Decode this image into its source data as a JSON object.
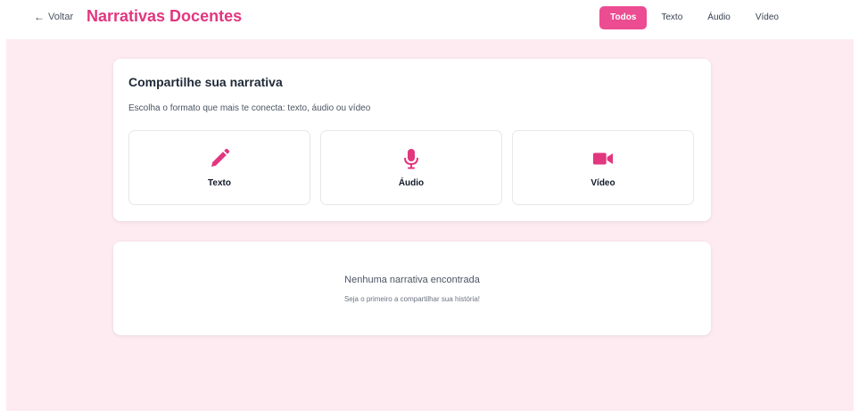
{
  "header": {
    "back_label": "Voltar",
    "title": "Narrativas Docentes",
    "filters": [
      "Todos",
      "Texto",
      "Áudio",
      "Vídeo"
    ],
    "active_filter": "Todos"
  },
  "share": {
    "title": "Compartilhe sua narrativa",
    "subtitle": "Escolha o formato que mais te conecta: texto, áudio ou vídeo",
    "options": [
      {
        "label": "Texto",
        "icon": "pencil-icon"
      },
      {
        "label": "Áudio",
        "icon": "microphone-icon"
      },
      {
        "label": "Vídeo",
        "icon": "video-camera-icon"
      }
    ]
  },
  "empty": {
    "title": "Nenhuma narrativa encontrada",
    "subtitle": "Seja o primeiro a compartilhar sua história!"
  },
  "colors": {
    "accent": "#e2367f",
    "active_filter_bg": "#ec4c91",
    "page_background": "#fdebf1"
  }
}
